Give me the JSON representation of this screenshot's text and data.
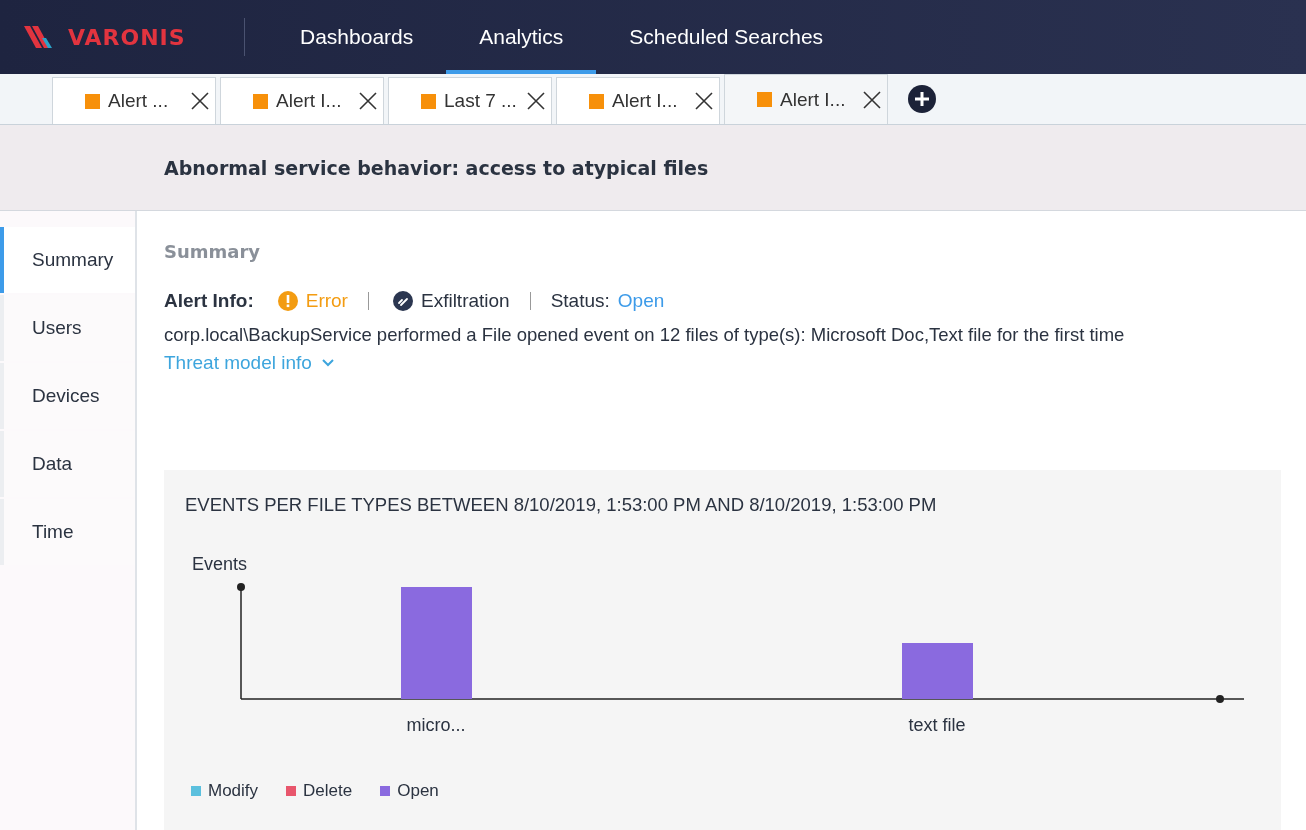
{
  "logo": {
    "text": "VARONIS"
  },
  "nav": [
    {
      "label": "Dashboards",
      "selected": false
    },
    {
      "label": "Analytics",
      "selected": true
    },
    {
      "label": "Scheduled Searches",
      "selected": false
    }
  ],
  "tabs": [
    {
      "label": "Alert ...",
      "selected": false
    },
    {
      "label": "Alert I...",
      "selected": false
    },
    {
      "label": "Last 7 ...",
      "selected": false
    },
    {
      "label": "Alert I...",
      "selected": false
    },
    {
      "label": "Alert I...",
      "selected": true
    }
  ],
  "page_title": "Abnormal service behavior: access to atypical files",
  "sidebar": [
    {
      "label": "Summary",
      "selected": true
    },
    {
      "label": "Users",
      "selected": false
    },
    {
      "label": "Devices",
      "selected": false
    },
    {
      "label": "Data",
      "selected": false
    },
    {
      "label": "Time",
      "selected": false
    }
  ],
  "summary": {
    "heading": "Summary",
    "alert_info_label": "Alert Info:",
    "severity": "Error",
    "category": "Exfiltration",
    "status_label": "Status:",
    "status": "Open",
    "description": "corp.local\\BackupService performed a File opened event on 12 files of type(s): Microsoft Doc,Text file for the first time",
    "threat_model_link": "Threat model info"
  },
  "chart": {
    "title": "EVENTS PER FILE TYPES BETWEEN 8/10/2019, 1:53:00 PM AND 8/10/2019, 1:53:00 PM",
    "ylabel": "Events",
    "categories": [
      "micro...",
      "text file"
    ],
    "legend": [
      {
        "label": "Modify",
        "color": "#5bc0de"
      },
      {
        "label": "Delete",
        "color": "#e8566c"
      },
      {
        "label": "Open",
        "color": "#8a6adf"
      }
    ]
  }
}
